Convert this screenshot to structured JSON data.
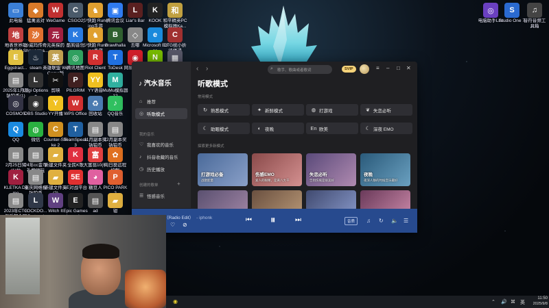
{
  "desktop": {
    "icons": [
      {
        "label": "此电脑",
        "color": "#3b7fd6",
        "glyph": "▭"
      },
      {
        "label": "猛禽派对",
        "color": "#d87a2a",
        "glyph": "◆"
      },
      {
        "label": "WeGame",
        "color": "#c03030",
        "glyph": "W"
      },
      {
        "label": "CSGO2",
        "color": "#4a5a6a",
        "glyph": "C"
      },
      {
        "label": "少快跑 Running手游",
        "color": "#e0a030",
        "glyph": "♞"
      },
      {
        "label": "腾讯会议",
        "color": "#2f7bf0",
        "glyph": "▣"
      },
      {
        "label": "Liar's Bar",
        "color": "#5a2020",
        "glyph": "L"
      },
      {
        "label": "KOOK",
        "color": "#222",
        "glyph": "K"
      },
      {
        "label": "和平精英PC模拟器Ka...",
        "color": "#c0a040",
        "glyph": "和"
      },
      {
        "label": "电脑助手Lite",
        "color": "#6a40c0",
        "glyph": "◎"
      },
      {
        "label": "Studio One 7",
        "color": "#2a6ad0",
        "glyph": "S"
      },
      {
        "label": "音符音频工具箱",
        "color": "#444",
        "glyph": "♫"
      },
      {
        "label": "地表世界助手平台",
        "color": "#c04040",
        "glyph": "地"
      },
      {
        "label": "沙威玛传奇 Shawarma...",
        "color": "#e07030",
        "glyph": "沙"
      },
      {
        "label": "元英探药",
        "color": "#a02040",
        "glyph": "元"
      },
      {
        "label": "酷狗音乐",
        "color": "#2a7ae0",
        "glyph": "K"
      },
      {
        "label": "少快跑 Running手游",
        "color": "#e0a030",
        "glyph": "♞"
      },
      {
        "label": "Brawlhalla",
        "color": "#306030",
        "glyph": "B"
      },
      {
        "label": "去哪",
        "color": "#888",
        "glyph": "◇"
      },
      {
        "label": "Microsoft Edge",
        "color": "#1a8adc",
        "glyph": "e"
      },
      {
        "label": "CTG统小折谈楼通",
        "color": "#a03030",
        "glyph": "C"
      },
      {
        "label": "Eggstract...",
        "color": "#e0c040",
        "glyph": "E"
      },
      {
        "label": "steam",
        "color": "#1b2838",
        "glyph": "♨"
      },
      {
        "label": "英雄联盟 WeGame版",
        "color": "#c0a050",
        "glyph": "英"
      },
      {
        "label": "腾讯地图",
        "color": "#30a060",
        "glyph": "◎"
      },
      {
        "label": "Riot Client",
        "color": "#d03030",
        "glyph": "R"
      },
      {
        "label": "ToDesk",
        "color": "#2070e0",
        "glyph": "T"
      },
      {
        "label": "网易云音乐",
        "color": "#d0202a",
        "glyph": "◉"
      },
      {
        "label": "NVIDIA",
        "color": "#76b900",
        "glyph": "N"
      },
      {
        "label": "v2-b9c92c...",
        "color": "#556",
        "glyph": "▦"
      },
      {
        "label": "2025年1月度钠铂币(1)",
        "color": "#888",
        "glyph": "▤"
      },
      {
        "label": "Logi Options+",
        "color": "#333",
        "glyph": "L"
      },
      {
        "label": "剪映",
        "color": "#111",
        "glyph": "✂"
      },
      {
        "label": "PILGRIM",
        "color": "#402020",
        "glyph": "P"
      },
      {
        "label": "YY语音",
        "color": "#f0c020",
        "glyph": "YY"
      },
      {
        "label": "MuMu模拟器12",
        "color": "#30b0a0",
        "glyph": "M"
      },
      {
        "label": "COSMOS",
        "color": "#334",
        "glyph": "◎"
      },
      {
        "label": "OBS Studio",
        "color": "#333",
        "glyph": "◉"
      },
      {
        "label": "YY开播",
        "color": "#f0c020",
        "glyph": "Y"
      },
      {
        "label": "WPS Office",
        "color": "#d03030",
        "glyph": "W"
      },
      {
        "label": "回收站",
        "color": "#4a7ab0",
        "glyph": "♻"
      },
      {
        "label": "QQ音乐",
        "color": "#30c060",
        "glyph": "♪"
      },
      {
        "label": "QQ",
        "color": "#1a8ae0",
        "glyph": "Q"
      },
      {
        "label": "微信",
        "color": "#2ab040",
        "glyph": "◍"
      },
      {
        "label": "Counter-Strike 2",
        "color": "#d09020",
        "glyph": "C"
      },
      {
        "label": "TeamSpeak 3",
        "color": "#2060a0",
        "glyph": "T"
      },
      {
        "label": "11月副本奖钠铂币",
        "color": "#888",
        "glyph": "▤"
      },
      {
        "label": "12月副本奖钠铂币",
        "color": "#888",
        "glyph": "▤"
      },
      {
        "label": "2月25日奖(1)拉",
        "color": "#888",
        "glyph": "▤"
      },
      {
        "label": "24年cc金币礼物领玩",
        "color": "#888",
        "glyph": "▤"
      },
      {
        "label": "新建文件夹",
        "color": "#e0b040",
        "glyph": "▰"
      },
      {
        "label": "全民K歌",
        "color": "#e03040",
        "glyph": "K"
      },
      {
        "label": "大富翁10(Richm...",
        "color": "#e04040",
        "glyph": "富"
      },
      {
        "label": "向日葵远程控制",
        "color": "#e07020",
        "glyph": "✿"
      },
      {
        "label": "KLETKA Demo",
        "color": "#a02040",
        "glyph": "K"
      },
      {
        "label": "重庆网络报钠铂币",
        "color": "#888",
        "glyph": "▤"
      },
      {
        "label": "新建文件夹(2)",
        "color": "#e0b040",
        "glyph": "▰"
      },
      {
        "label": "5E对战平台",
        "color": "#e03030",
        "glyph": "5E"
      },
      {
        "label": "糖豆人",
        "color": "#e060a0",
        "glyph": "◕"
      },
      {
        "label": "PICO PARK 2",
        "color": "#e06030",
        "glyph": "P"
      },
      {
        "label": "2023年CTG俱乐部合同",
        "color": "#888",
        "glyph": "▤"
      },
      {
        "label": "LOCKDO... Protocol",
        "color": "#303848",
        "glyph": "L"
      },
      {
        "label": "Witch It",
        "color": "#604080",
        "glyph": "W"
      },
      {
        "label": "Epic Games Launcher",
        "color": "#222",
        "glyph": "E"
      },
      {
        "label": "ad",
        "color": "#555",
        "glyph": "▤"
      },
      {
        "label": "钳",
        "color": "#e0b040",
        "glyph": "▰"
      }
    ]
  },
  "app": {
    "logo": "汽水音乐",
    "search_placeholder": "歌手、歌曲或者歌词",
    "badge": "SVIP",
    "nav": [
      {
        "label": "推荐",
        "icon": "⌂"
      },
      {
        "label": "听歌模式",
        "icon": "◎"
      }
    ],
    "my_music_label": "我的音乐",
    "my_music": [
      {
        "label": "我喜欢的音乐",
        "icon": "♡"
      },
      {
        "label": "抖音收藏的音乐",
        "icon": "♪"
      },
      {
        "label": "历史播放",
        "icon": "◷"
      }
    ],
    "created_label": "创建的歌单",
    "created": [
      {
        "label": "怪感音乐",
        "icon": "☰"
      }
    ],
    "page_title": "听歌模式",
    "common_modes_label": "常用模式",
    "modes": [
      {
        "label": "熟悉模式",
        "icon": "↻"
      },
      {
        "label": "新鲜模式",
        "icon": "✦"
      },
      {
        "label": "打游戏",
        "icon": "◍"
      },
      {
        "label": "失恋必听",
        "icon": "❦"
      },
      {
        "label": "助眠模式",
        "icon": "☾"
      },
      {
        "label": "夜晚",
        "icon": "◐"
      },
      {
        "label": "欧美",
        "icon": "En"
      },
      {
        "label": "深夜 EMO",
        "icon": "☾"
      }
    ],
    "explore_label": "探索更多新模式",
    "cards": [
      {
        "title": "打游戏必备",
        "sub": "战歌能量",
        "color1": "#4a6a9a",
        "color2": "#8aa0c8"
      },
      {
        "title": "伤感EMO",
        "sub": "爱人的眼睛，是黄八大千",
        "color1": "#8a4a4a",
        "color2": "#d49090"
      },
      {
        "title": "失恋必听",
        "sub": "告别伤痕是很美好",
        "color1": "#5a4a7a",
        "color2": "#b08ab0"
      },
      {
        "title": "夜晚",
        "sub": "夜深人静的时候音乐最好",
        "color1": "#2a5a7a",
        "color2": "#6aa0c0"
      }
    ],
    "player": {
      "track": "ellis（Radio Edit）",
      "artist": "- iphonk",
      "quality": "音质"
    }
  },
  "taskbar": {
    "lang": "英",
    "time": "11:50",
    "date": "2025/9/8"
  }
}
